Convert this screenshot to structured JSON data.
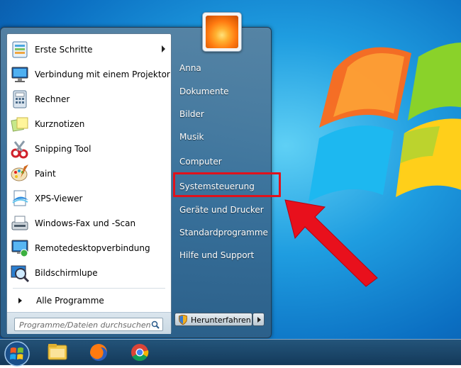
{
  "start_menu": {
    "programs": [
      {
        "label": "Erste Schritte",
        "icon": "getting-started-icon",
        "has_submenu": true
      },
      {
        "label": "Verbindung mit einem Projektor",
        "icon": "projector-icon",
        "has_submenu": false
      },
      {
        "label": "Rechner",
        "icon": "calculator-icon",
        "has_submenu": false
      },
      {
        "label": "Kurznotizen",
        "icon": "sticky-notes-icon",
        "has_submenu": false
      },
      {
        "label": "Snipping Tool",
        "icon": "scissors-icon",
        "has_submenu": false
      },
      {
        "label": "Paint",
        "icon": "paint-palette-icon",
        "has_submenu": false
      },
      {
        "label": "XPS-Viewer",
        "icon": "xps-viewer-icon",
        "has_submenu": false
      },
      {
        "label": "Windows-Fax und -Scan",
        "icon": "fax-icon",
        "has_submenu": false
      },
      {
        "label": "Remotedesktopverbindung",
        "icon": "remote-desktop-icon",
        "has_submenu": false
      },
      {
        "label": "Bildschirmlupe",
        "icon": "magnifier-icon",
        "has_submenu": false
      }
    ],
    "all_programs": "Alle Programme",
    "search_placeholder": "Programme/Dateien durchsuchen",
    "right_links": [
      "Anna",
      "Dokumente",
      "Bilder",
      "Musik",
      "Computer",
      "Systemsteuerung",
      "Geräte und Drucker",
      "Standardprogramme",
      "Hilfe und Support"
    ],
    "highlighted_link": "Systemsteuerung",
    "shutdown_label": "Herunterfahren"
  },
  "taskbar": {
    "items": [
      "windows-start-orb",
      "file-explorer-icon",
      "firefox-icon",
      "chrome-icon"
    ]
  },
  "colors": {
    "highlight_red": "#e0121c",
    "desktop_blue": "#1f9de0"
  }
}
